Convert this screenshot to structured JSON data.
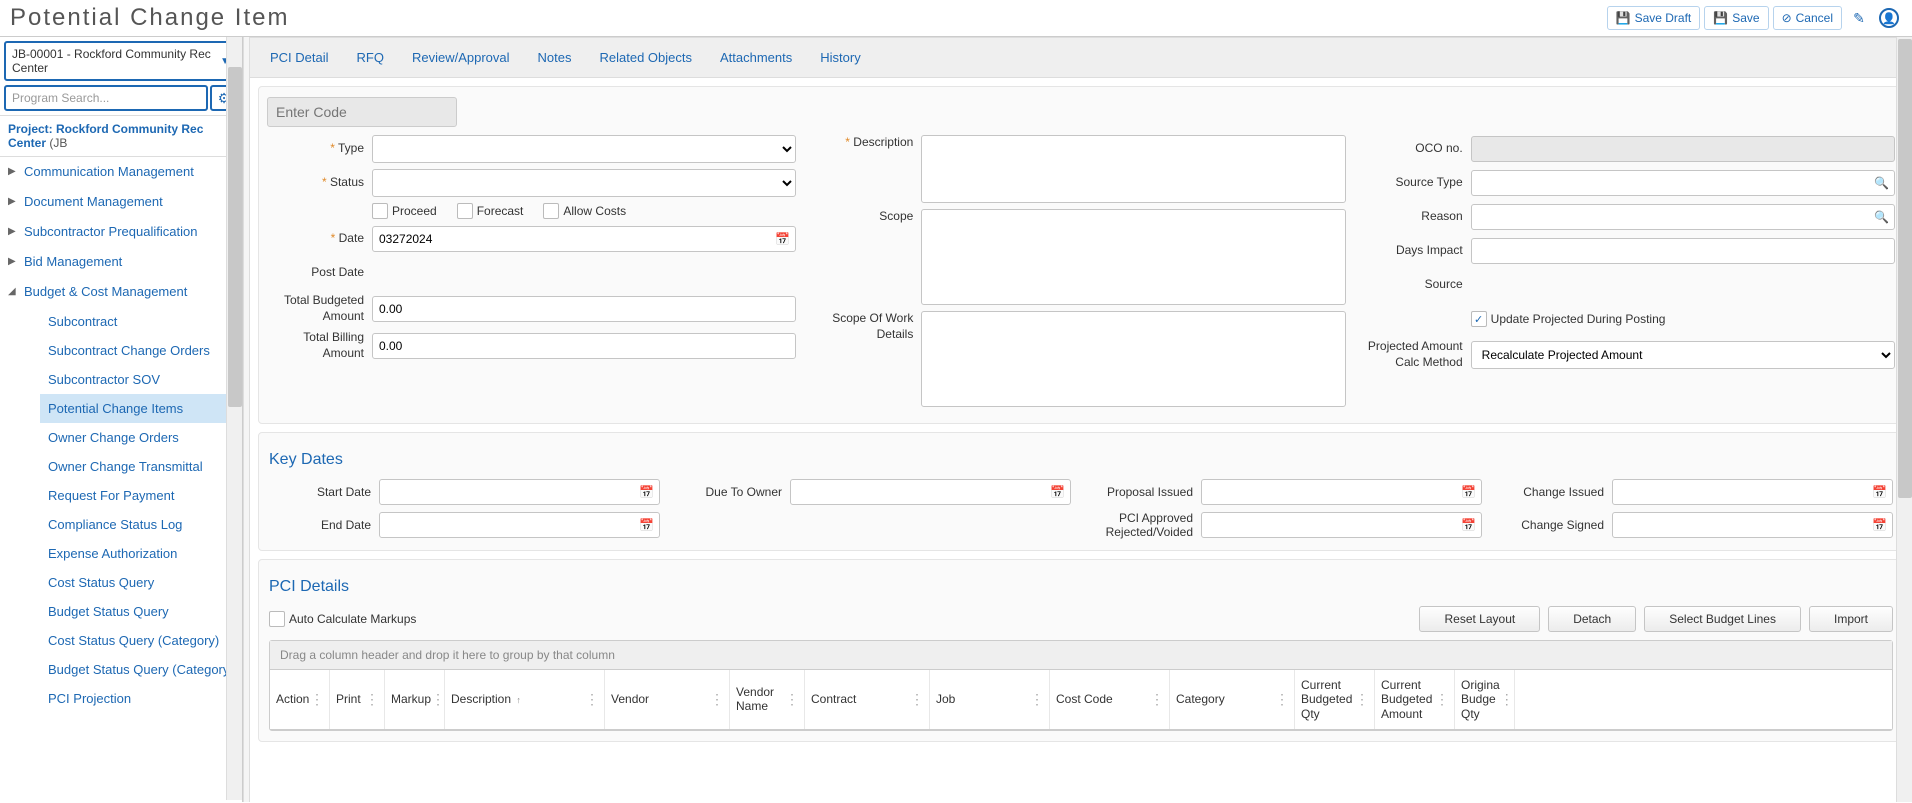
{
  "page_title": "Potential Change Item",
  "header_actions": {
    "save_draft": "Save Draft",
    "save": "Save",
    "cancel": "Cancel"
  },
  "sidebar": {
    "project_selector": "JB-00001 - Rockford Community Rec Center",
    "search_placeholder": "Program Search...",
    "project_link": "Project: Rockford Community Rec Center",
    "project_link_suffix": "(JB",
    "sections": [
      {
        "label": "Communication Management",
        "expanded": false
      },
      {
        "label": "Document Management",
        "expanded": false
      },
      {
        "label": "Subcontractor Prequalification",
        "expanded": false
      },
      {
        "label": "Bid Management",
        "expanded": false
      },
      {
        "label": "Budget & Cost Management",
        "expanded": true,
        "children": [
          {
            "label": "Subcontract"
          },
          {
            "label": "Subcontract Change Orders"
          },
          {
            "label": "Subcontractor SOV"
          },
          {
            "label": "Potential Change Items",
            "active": true
          },
          {
            "label": "Owner Change Orders"
          },
          {
            "label": "Owner Change Transmittal"
          },
          {
            "label": "Request For Payment"
          },
          {
            "label": "Compliance Status Log"
          },
          {
            "label": "Expense Authorization"
          },
          {
            "label": "Cost Status Query"
          },
          {
            "label": "Budget Status Query"
          },
          {
            "label": "Cost Status Query (Category)"
          },
          {
            "label": "Budget Status Query (Category)"
          },
          {
            "label": "PCI Projection"
          }
        ]
      }
    ]
  },
  "tabs": [
    "PCI Detail",
    "RFQ",
    "Review/Approval",
    "Notes",
    "Related Objects",
    "Attachments",
    "History"
  ],
  "form": {
    "code_placeholder": "Enter Code",
    "labels": {
      "type": "Type",
      "status": "Status",
      "date": "Date",
      "post_date": "Post Date",
      "total_budgeted": "Total Budgeted Amount",
      "total_billing": "Total Billing Amount",
      "description": "Description",
      "scope": "Scope",
      "scope_details": "Scope Of Work Details",
      "oco": "OCO no.",
      "source_type": "Source Type",
      "reason": "Reason",
      "days_impact": "Days Impact",
      "source": "Source",
      "update_projected": "Update Projected During Posting",
      "calc_method": "Projected Amount Calc Method"
    },
    "checkboxes": {
      "proceed": "Proceed",
      "forecast": "Forecast",
      "allow_costs": "Allow Costs"
    },
    "values": {
      "date": "03272024",
      "total_budgeted": "0.00",
      "total_billing": "0.00",
      "calc_method": "Recalculate Projected Amount"
    }
  },
  "key_dates": {
    "title": "Key Dates",
    "labels": {
      "start": "Start Date",
      "end": "End Date",
      "due_owner": "Due To Owner",
      "proposal": "Proposal Issued",
      "pci_approved": "PCI Approved Rejected/Voided",
      "change_issued": "Change Issued",
      "change_signed": "Change Signed"
    }
  },
  "pci_details": {
    "title": "PCI Details",
    "auto_calc": "Auto Calculate Markups",
    "buttons": {
      "reset": "Reset Layout",
      "detach": "Detach",
      "select_lines": "Select Budget Lines",
      "import": "Import"
    },
    "group_hint": "Drag a column header and drop it here to group by that column",
    "columns": [
      "Action",
      "Print",
      "Markup",
      "Description",
      "Vendor",
      "Vendor Name",
      "Contract",
      "Job",
      "Cost Code",
      "Category",
      "Current Budgeted Qty",
      "Current Budgeted Amount",
      "Origina Budge Qty"
    ]
  }
}
